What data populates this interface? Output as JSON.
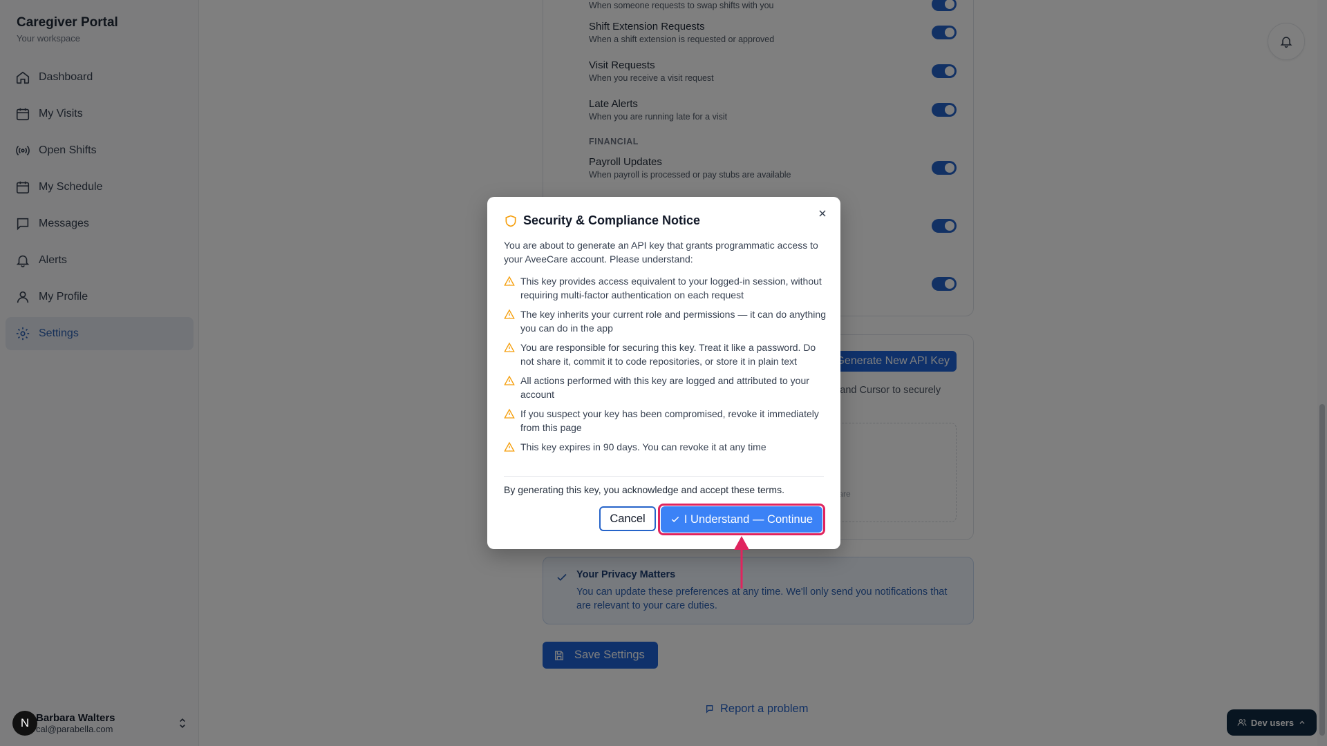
{
  "brand": {
    "title": "Caregiver Portal",
    "subtitle": "Your workspace"
  },
  "nav": {
    "items": [
      {
        "label": "Dashboard",
        "icon": "home-icon"
      },
      {
        "label": "My Visits",
        "icon": "calendar-icon"
      },
      {
        "label": "Open Shifts",
        "icon": "broadcast-icon"
      },
      {
        "label": "My Schedule",
        "icon": "calendar-icon"
      },
      {
        "label": "Messages",
        "icon": "message-icon"
      },
      {
        "label": "Alerts",
        "icon": "bell-icon"
      },
      {
        "label": "My Profile",
        "icon": "user-icon"
      },
      {
        "label": "Settings",
        "icon": "gear-icon",
        "active": true
      }
    ]
  },
  "user": {
    "initial": "N",
    "name": "Barbara Walters",
    "email": "cal@parabella.com"
  },
  "notifications": {
    "partial_top_desc": "When someone requests to swap shifts with you",
    "rows": [
      {
        "title": "Shift Extension Requests",
        "desc": "When a shift extension is requested or approved",
        "enabled": true
      },
      {
        "title": "Visit Requests",
        "desc": "When you receive a visit request",
        "enabled": true
      },
      {
        "title": "Late Alerts",
        "desc": "When you are running late for a visit",
        "enabled": true
      }
    ],
    "financial_label": "FINANCIAL",
    "financial_rows": [
      {
        "title": "Payroll Updates",
        "desc": "When payroll is processed or pay stubs are available",
        "enabled": true
      }
    ]
  },
  "api": {
    "generate_label": "Generate New API Key",
    "desc_partial": "T, and Cursor to securely",
    "dashed_partial": "eCare"
  },
  "privacy": {
    "title": "Your Privacy Matters",
    "body": "You can update these preferences at any time. We'll only send you notifications that are relevant to your care duties."
  },
  "save_label": "Save Settings",
  "report_label": "Report a problem",
  "dev_label": "Dev users",
  "modal": {
    "title": "Security & Compliance Notice",
    "intro": "You are about to generate an API key that grants programmatic access to your AveeCare account. Please understand:",
    "warnings": [
      "This key provides access equivalent to your logged-in session, without requiring multi-factor authentication on each request",
      "The key inherits your current role and permissions — it can do anything you can do in the app",
      "You are responsible for securing this key. Treat it like a password. Do not share it, commit it to code repositories, or store it in plain text",
      "All actions performed with this key are logged and attributed to your account",
      "If you suspect your key has been compromised, revoke it immediately from this page",
      "This key expires in 90 days. You can revoke it at any time"
    ],
    "ack": "By generating this key, you acknowledge and accept these terms.",
    "cancel_label": "Cancel",
    "continue_label": "I Understand — Continue"
  },
  "colors": {
    "accent": "#1f63d6",
    "warning": "#f59e0b",
    "highlight": "#e0245e",
    "overlay": "rgba(0,0,0,0.5)"
  }
}
